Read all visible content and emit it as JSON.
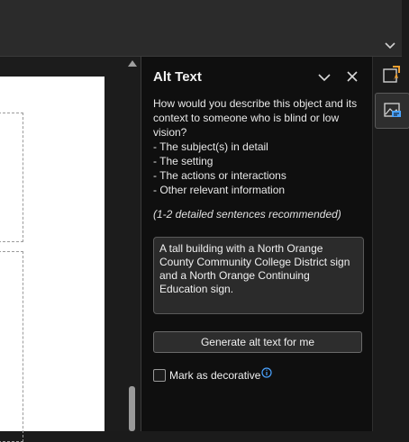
{
  "alt_text_pane": {
    "title": "Alt Text",
    "instructions": [
      "How would you describe this object and its",
      "context to someone who is blind or low",
      "vision?",
      "- The subject(s) in detail",
      "- The setting",
      "- The actions or interactions",
      "- Other relevant information"
    ],
    "recommendation": "(1-2 detailed sentences recommended)",
    "alt_text_value": "A tall building with a North Orange County Community College District sign and a North Orange Continuing Education sign.",
    "generate_button_label": "Generate alt text for me",
    "decorative_label": "Mark as decorative",
    "decorative_checked": false
  },
  "icons": {
    "pane_collapse": "chevron-down-icon",
    "pane_close": "close-icon",
    "ribbon_expand": "chevron-down-icon",
    "rail_first": "designer-icon",
    "rail_second": "alt-text-icon",
    "info": "info-icon"
  },
  "colors": {
    "accent": "#4aa3ff",
    "pane_background": "#0f0f0f",
    "rail_icon_orange": "#f0a030"
  }
}
